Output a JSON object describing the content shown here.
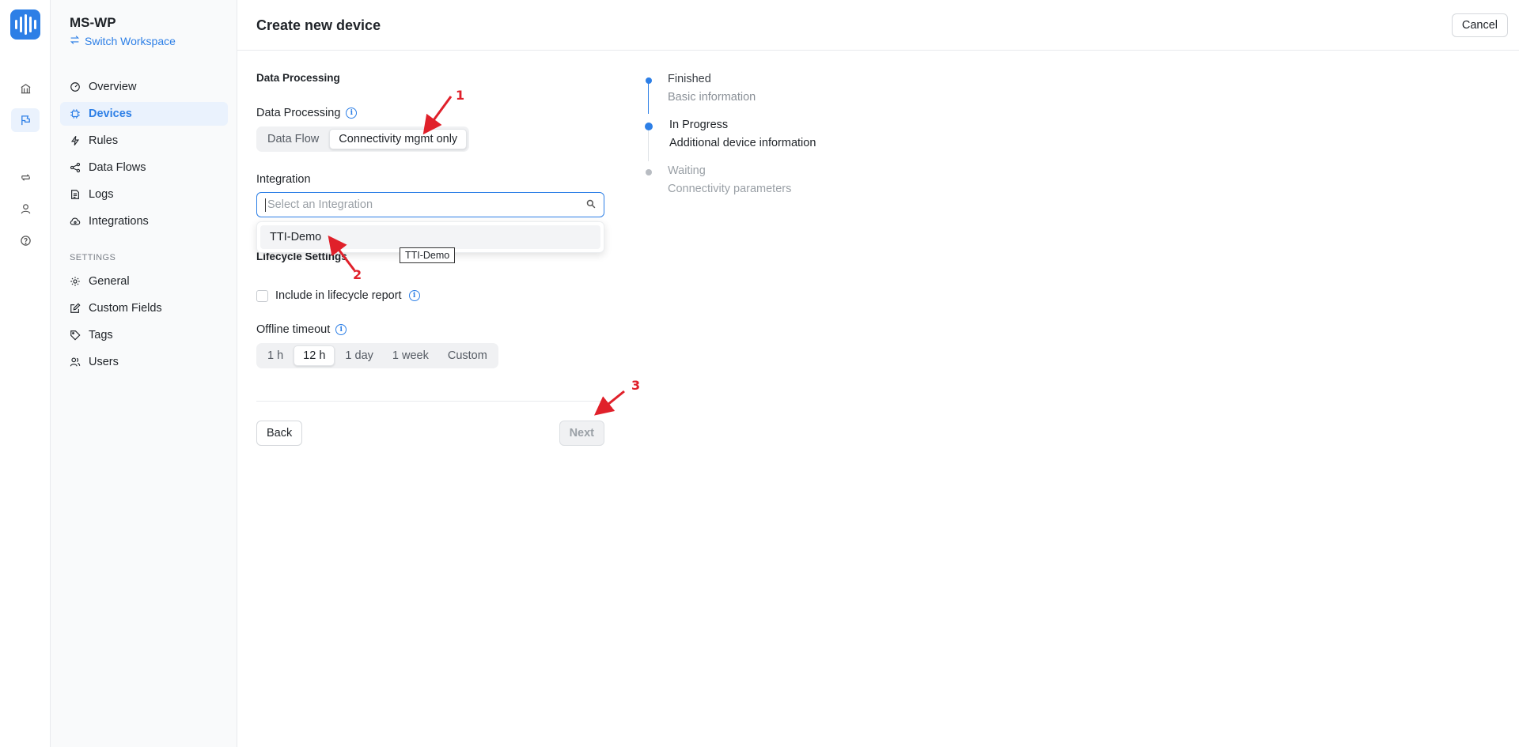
{
  "rail": {
    "icons": [
      "home-icon",
      "devices-flag-icon",
      "transfer-icon",
      "user-icon",
      "help-icon"
    ]
  },
  "sidebar": {
    "workspace_name": "MS-WP",
    "switch_label": "Switch Workspace",
    "items": [
      {
        "label": "Overview",
        "icon": "gauge-icon"
      },
      {
        "label": "Devices",
        "icon": "chip-icon",
        "active": true
      },
      {
        "label": "Rules",
        "icon": "bolt-icon"
      },
      {
        "label": "Data Flows",
        "icon": "share-icon"
      },
      {
        "label": "Logs",
        "icon": "log-icon"
      },
      {
        "label": "Integrations",
        "icon": "cloud-icon"
      }
    ],
    "settings_heading": "SETTINGS",
    "settings_items": [
      {
        "label": "General",
        "icon": "gear-icon"
      },
      {
        "label": "Custom Fields",
        "icon": "edit-icon"
      },
      {
        "label": "Tags",
        "icon": "tag-icon"
      },
      {
        "label": "Users",
        "icon": "users-icon"
      }
    ]
  },
  "header": {
    "title": "Create new device",
    "cancel_label": "Cancel"
  },
  "form": {
    "section_data_processing": "Data Processing",
    "data_processing_label": "Data Processing",
    "data_processing_options": [
      "Data Flow",
      "Connectivity mgmt only"
    ],
    "data_processing_selected": "Connectivity mgmt only",
    "integration_label": "Integration",
    "integration_placeholder": "Select an Integration",
    "integration_options": [
      "TTI-Demo"
    ],
    "tooltip": "TTI-Demo",
    "section_lifecycle": "Lifecycle Settings",
    "lifecycle_checkbox_label": "Include in lifecycle report",
    "offline_timeout_label": "Offline timeout",
    "offline_timeout_options": [
      "1 h",
      "12 h",
      "1 day",
      "1 week",
      "Custom"
    ],
    "offline_timeout_selected": "12 h",
    "back_label": "Back",
    "next_label": "Next"
  },
  "steps": [
    {
      "status": "Finished",
      "description": "Basic information",
      "state": "finished"
    },
    {
      "status": "In Progress",
      "description": "Additional device information",
      "state": "in-progress"
    },
    {
      "status": "Waiting",
      "description": "Connectivity parameters",
      "state": "waiting"
    }
  ],
  "annotations": [
    "1",
    "2",
    "3"
  ],
  "colors": {
    "accent": "#2d7fe6",
    "annotation": "#e0202a",
    "waiting_gray": "#b8bcc2"
  }
}
